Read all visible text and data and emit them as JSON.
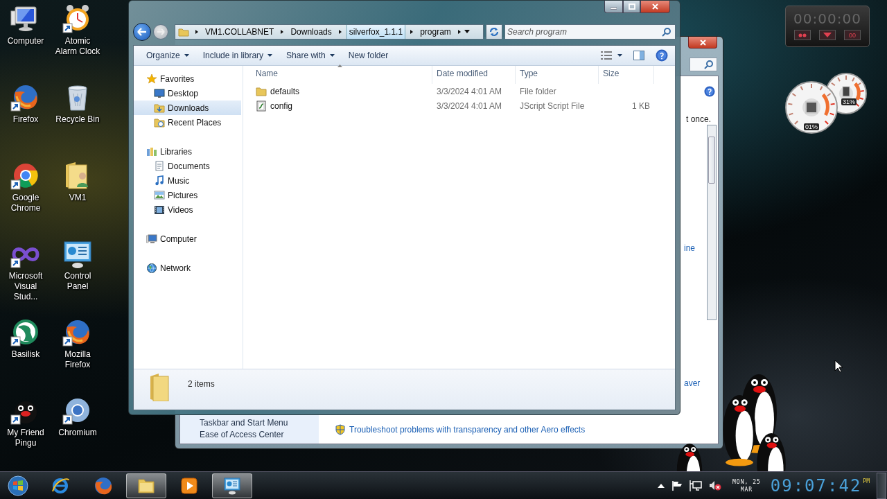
{
  "desktop_icons": [
    {
      "label": "Computer",
      "kind": "computer",
      "shortcut": false
    },
    {
      "label": "Atomic Alarm Clock",
      "kind": "alarm-clock",
      "shortcut": true
    },
    {
      "label": "Firefox",
      "kind": "firefox",
      "shortcut": true
    },
    {
      "label": "Recycle Bin",
      "kind": "recycle-bin",
      "shortcut": false
    },
    {
      "label": "Google Chrome",
      "kind": "chrome",
      "shortcut": true
    },
    {
      "label": "VM1",
      "kind": "user-folder",
      "shortcut": false
    },
    {
      "label": "Microsoft Visual Stud...",
      "kind": "infinity",
      "shortcut": true
    },
    {
      "label": "Control Panel",
      "kind": "control-panel",
      "shortcut": false
    },
    {
      "label": "Basilisk",
      "kind": "basilisk",
      "shortcut": true
    },
    {
      "label": "Mozilla Firefox",
      "kind": "firefox",
      "shortcut": true
    },
    {
      "label": "My Friend Pingu",
      "kind": "penguin",
      "shortcut": true
    },
    {
      "label": "Chromium",
      "kind": "chromium",
      "shortcut": true
    }
  ],
  "background_window": {
    "fragments": [
      {
        "text": "t once.",
        "kind": "text"
      },
      {
        "text": "ine",
        "kind": "link"
      },
      {
        "text": "aver",
        "kind": "link"
      }
    ],
    "nav_items": [
      "Taskbar and Start Menu",
      "Ease of Access Center"
    ],
    "link": "Troubleshoot problems with transparency and other Aero effects"
  },
  "explorer": {
    "breadcrumb": [
      {
        "label": "VM1.COLLABNET",
        "selected": false
      },
      {
        "label": "Downloads",
        "selected": false
      },
      {
        "label": "silverfox_1.1.1",
        "selected": true
      },
      {
        "label": "program",
        "selected": false
      }
    ],
    "search": {
      "placeholder": "Search program"
    },
    "toolbar": [
      {
        "label": "Organize",
        "dropdown": true
      },
      {
        "label": "Include in library",
        "dropdown": true
      },
      {
        "label": "Share with",
        "dropdown": true
      },
      {
        "label": "New folder",
        "dropdown": false
      }
    ],
    "nav": [
      {
        "label": "Favorites",
        "kind": "star",
        "selected": false,
        "children": [
          {
            "label": "Desktop",
            "kind": "desktop",
            "selected": false
          },
          {
            "label": "Downloads",
            "kind": "downloads",
            "selected": true
          },
          {
            "label": "Recent Places",
            "kind": "recent",
            "selected": false
          }
        ]
      },
      {
        "label": "Libraries",
        "kind": "library",
        "selected": false,
        "children": [
          {
            "label": "Documents",
            "kind": "documents",
            "selected": false
          },
          {
            "label": "Music",
            "kind": "music",
            "selected": false
          },
          {
            "label": "Pictures",
            "kind": "pictures",
            "selected": false
          },
          {
            "label": "Videos",
            "kind": "videos",
            "selected": false
          }
        ]
      },
      {
        "label": "Computer",
        "kind": "computer",
        "selected": false
      },
      {
        "label": "Network",
        "kind": "network",
        "selected": false
      }
    ],
    "columns": [
      {
        "label": "Name",
        "sorted": true
      },
      {
        "label": "Date modified",
        "sorted": false
      },
      {
        "label": "Type",
        "sorted": false
      },
      {
        "label": "Size",
        "sorted": false
      }
    ],
    "files": [
      {
        "name": "defaults",
        "date": "3/3/2024 4:01 AM",
        "type": "File folder",
        "kind": "folder"
      },
      {
        "name": "config",
        "date": "3/3/2024 4:01 AM",
        "type": "JScript Script File",
        "size": "1 KB",
        "kind": "script"
      }
    ],
    "status": "2 items"
  },
  "gadgets": {
    "timer": {
      "time": "00:00:00",
      "buttons": [
        {
          "kind": "record"
        },
        {
          "kind": "menu"
        },
        {
          "kind": "text",
          "label": "00"
        }
      ]
    },
    "meters": [
      {
        "reading": "01%",
        "kind": "cpu"
      },
      {
        "reading": "31%",
        "kind": "memory"
      }
    ]
  },
  "taskbar": {
    "apps": [
      {
        "kind": "ie",
        "active": false
      },
      {
        "kind": "firefox",
        "active": false
      },
      {
        "kind": "explorer",
        "active": true
      },
      {
        "kind": "media",
        "active": false
      },
      {
        "kind": "control-panel",
        "active": true
      }
    ],
    "tray": [
      {
        "kind": "up-arrow"
      },
      {
        "kind": "flag"
      },
      {
        "kind": "network"
      },
      {
        "kind": "volume-muted"
      }
    ],
    "date_day": "MON, 25",
    "date_month": "MAR",
    "clock": "09:07:42",
    "ampm": "PM"
  }
}
